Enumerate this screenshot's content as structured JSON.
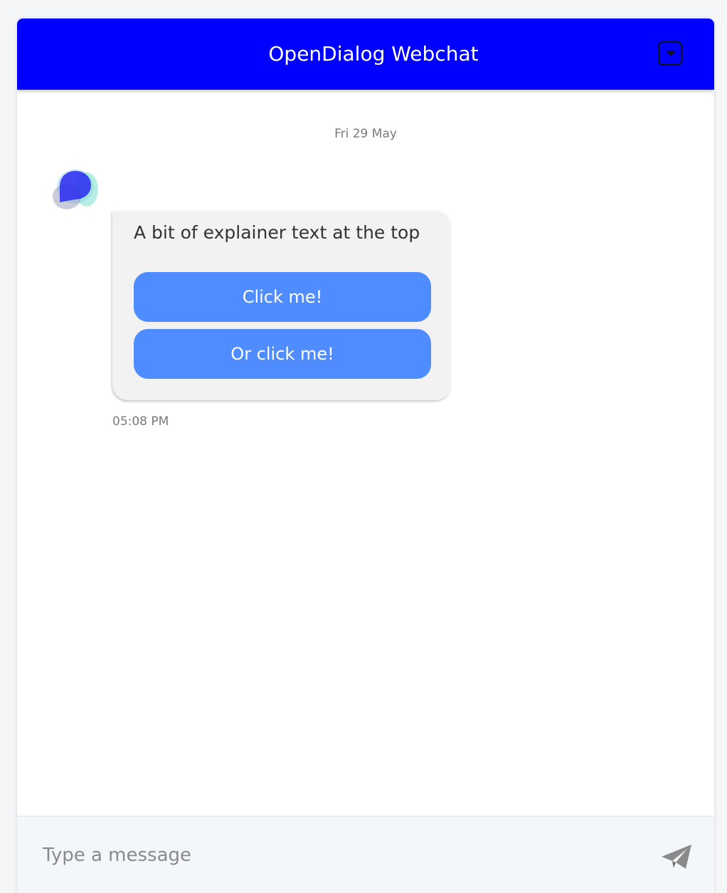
{
  "header": {
    "title": "OpenDialog Webchat",
    "collapse_icon": "chevron-down-icon",
    "background_color": "#0000ff"
  },
  "conversation": {
    "date_separator": "Fri 29 May",
    "messages": [
      {
        "author": "bot",
        "avatar_icon": "opendialog-logo-icon",
        "text": "A bit of explainer text at the top",
        "buttons": [
          {
            "label": "Click me!"
          },
          {
            "label": "Or click me!"
          }
        ],
        "time": "05:08 PM"
      }
    ]
  },
  "composer": {
    "placeholder": "Type a message",
    "value": "",
    "send_icon": "paper-plane-icon"
  },
  "colors": {
    "accent": "#0000ff",
    "button": "#4e8cff",
    "bubble": "#f2f2f2"
  }
}
